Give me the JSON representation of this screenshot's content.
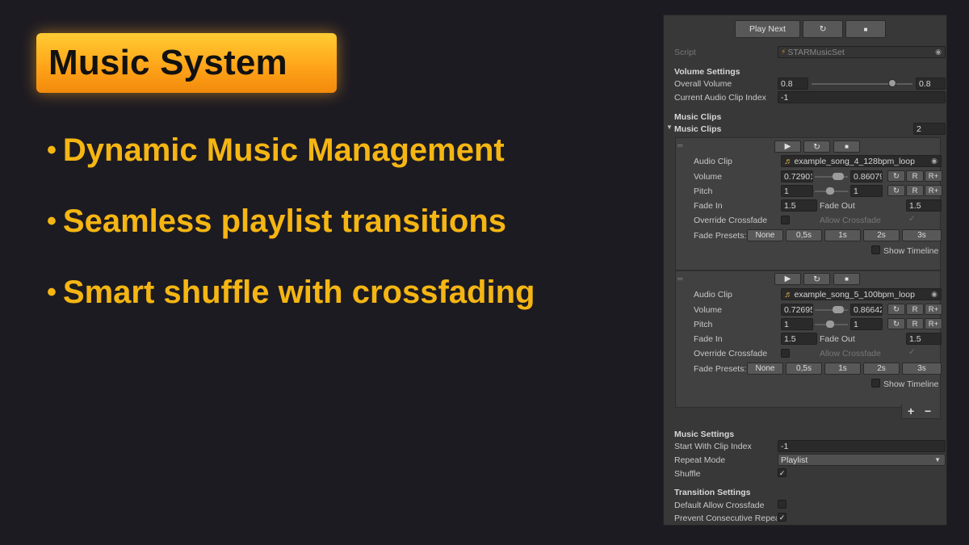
{
  "slide": {
    "title": "Music System",
    "bullets": [
      "Dynamic Music Management",
      "Seamless playlist transitions",
      "Smart shuffle with crossfading"
    ]
  },
  "inspector": {
    "top_buttons": {
      "play_next": "Play Next",
      "restart": "↻",
      "stop": "■"
    },
    "script_label": "Script",
    "script_value": "STARMusicSet",
    "volume_settings": {
      "header": "Volume Settings",
      "overall_volume_label": "Overall Volume",
      "overall_volume_value": "0.8",
      "overall_volume_level": 0.8,
      "overall_volume_field": "0.8",
      "current_clip_label": "Current Audio Clip Index",
      "current_clip_value": "-1"
    },
    "music_clips": {
      "header": "Music Clips",
      "list_label": "Music Clips",
      "count": "2",
      "clips": [
        {
          "audio_clip_label": "Audio Clip",
          "audio_clip": "example_song_4_128bpm_loop",
          "volume_label": "Volume",
          "volume_min": "0.72901",
          "volume_max": "0.86079",
          "pitch_label": "Pitch",
          "pitch_min": "1",
          "pitch_max": "1",
          "fade_in_label": "Fade In",
          "fade_in": "1.5",
          "fade_out_label": "Fade Out",
          "fade_out": "1.5",
          "override_label": "Override Crossfade",
          "allow_label": "Allow Crossfade",
          "presets_label": "Fade Presets:",
          "presets": [
            "None",
            "0,5s",
            "1s",
            "2s",
            "3s"
          ],
          "show_timeline": "Show Timeline",
          "reset_icon": "↻",
          "r_label": "R",
          "rplus_label": "R+"
        },
        {
          "audio_clip_label": "Audio Clip",
          "audio_clip": "example_song_5_100bpm_loop",
          "volume_label": "Volume",
          "volume_min": "0.72695",
          "volume_max": "0.86642",
          "pitch_label": "Pitch",
          "pitch_min": "1",
          "pitch_max": "1",
          "fade_in_label": "Fade In",
          "fade_in": "1.5",
          "fade_out_label": "Fade Out",
          "fade_out": "1.5",
          "override_label": "Override Crossfade",
          "allow_label": "Allow Crossfade",
          "presets_label": "Fade Presets:",
          "presets": [
            "None",
            "0,5s",
            "1s",
            "2s",
            "3s"
          ],
          "show_timeline": "Show Timeline",
          "reset_icon": "↻",
          "r_label": "R",
          "rplus_label": "R+"
        }
      ],
      "add_label": "+",
      "remove_label": "−"
    },
    "music_settings": {
      "header": "Music Settings",
      "start_label": "Start With Clip Index",
      "start_value": "-1",
      "repeat_label": "Repeat Mode",
      "repeat_value": "Playlist",
      "shuffle_label": "Shuffle"
    },
    "transition_settings": {
      "header": "Transition Settings",
      "default_allow_label": "Default Allow Crossfade",
      "prevent_label": "Prevent Consecutive Repea"
    }
  },
  "colors": {
    "accent": "#f5b613",
    "badge": "#ffa51a",
    "background": "#1d1b22",
    "panel": "#383838"
  }
}
